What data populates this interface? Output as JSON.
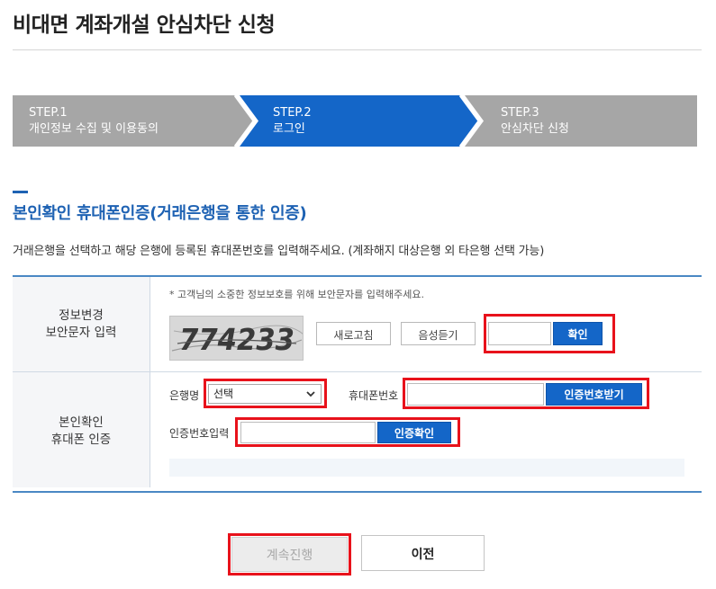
{
  "page_title": "비대면 계좌개설 안심차단 신청",
  "steps": [
    {
      "number": "STEP.1",
      "label": "개인정보 수집 및 이용동의",
      "state": "done"
    },
    {
      "number": "STEP.2",
      "label": "로그인",
      "state": "active"
    },
    {
      "number": "STEP.3",
      "label": "안심차단 신청",
      "state": "pending"
    }
  ],
  "colors": {
    "step_inactive": "#a6a6a6",
    "step_active": "#1466c8",
    "section_title": "#1e62b3",
    "highlight": "#e8121b"
  },
  "section": {
    "title": "본인확인 휴대폰인증(거래은행을 통한 인증)",
    "description": "거래은행을 선택하고 해당 은행에 등록된 휴대폰번호를 입력해주세요. (계좌해지 대상은행 외 타은행 선택 가능)"
  },
  "captcha_row": {
    "heading_line1": "정보변경",
    "heading_line2": "보안문자 입력",
    "note": "* 고객님의 소중한 정보보호를 위해 보안문자를 입력해주세요.",
    "captcha_text": "774233",
    "refresh_label": "새로고침",
    "audio_label": "음성듣기",
    "input_value": "",
    "confirm_label": "확인"
  },
  "phone_row": {
    "heading_line1": "본인확인",
    "heading_line2": "휴대폰 인증",
    "bank_label": "은행명",
    "bank_selected": "선택",
    "phone_label": "휴대폰번호",
    "phone_value": "",
    "request_code_label": "인증번호받기",
    "code_label": "인증번호입력",
    "code_value": "",
    "verify_label": "인증확인"
  },
  "footer": {
    "continue_label": "계속진행",
    "prev_label": "이전"
  }
}
